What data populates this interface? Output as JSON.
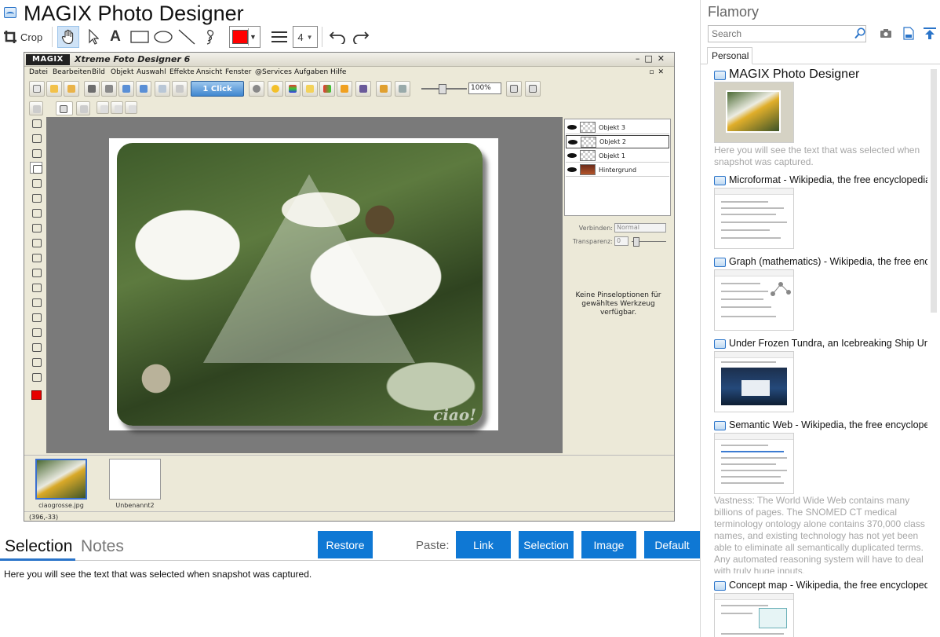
{
  "window": {
    "title": "MAGIX Photo Designer"
  },
  "toolbar": {
    "crop_label": "Crop",
    "line_width": "4",
    "color": "#ff0000"
  },
  "magix": {
    "logo": "MAGIX",
    "app_title": "Xtreme Foto Designer 6",
    "menu": [
      "Datei",
      "Bearbeiten",
      "Bild",
      "Objekt",
      "Auswahl",
      "Effekte",
      "Ansicht",
      "Fenster",
      "@Services",
      "Aufgaben",
      "Hilfe"
    ],
    "one_click": "1 Click",
    "zoom": "100%",
    "watermark": "ciao!",
    "layers": [
      "Objekt 3",
      "Objekt 2",
      "Objekt 1",
      "Hintergrund"
    ],
    "props": {
      "blend_label": "Verbinden:",
      "blend_value": "Normal",
      "transparency_label": "Transparenz:",
      "transparency_value": "0"
    },
    "no_options": "Keine Pinseloptionen für gewähltes Werkzeug verfügbar.",
    "thumbnails": [
      "ciaogrosse.jpg",
      "Unbenannt2"
    ],
    "status": "(396,-33)"
  },
  "tabs": {
    "selection": "Selection",
    "notes": "Notes"
  },
  "buttons": {
    "restore": "Restore",
    "paste_label": "Paste:",
    "link": "Link",
    "selection": "Selection",
    "image": "Image",
    "default": "Default"
  },
  "selection_text": "Here you will see the text that was selected when snapshot was captured.",
  "panel": {
    "title": "Flamory",
    "search_placeholder": "Search",
    "tab": "Personal",
    "entries": [
      {
        "title": "MAGIX Photo Designer",
        "text": "Here you will see the text that was selected when snapshot was captured."
      },
      {
        "title": "Microformat - Wikipedia, the free encyclopedia"
      },
      {
        "title": "Graph (mathematics) - Wikipedia, the free ency"
      },
      {
        "title": "Under Frozen Tundra, an Icebreaking Ship Unco"
      },
      {
        "title": "Semantic Web - Wikipedia, the free encycloped",
        "text": "Vastness: The World Wide Web contains many billions of pages. The SNOMED CT medical terminology ontology alone contains 370,000 class names, and existing technology has not yet been able to eliminate all semantically duplicated terms. Any automated reasoning system will have to deal with truly huge inputs."
      },
      {
        "title": "Concept map - Wikipedia, the free encyclopedi"
      }
    ]
  }
}
